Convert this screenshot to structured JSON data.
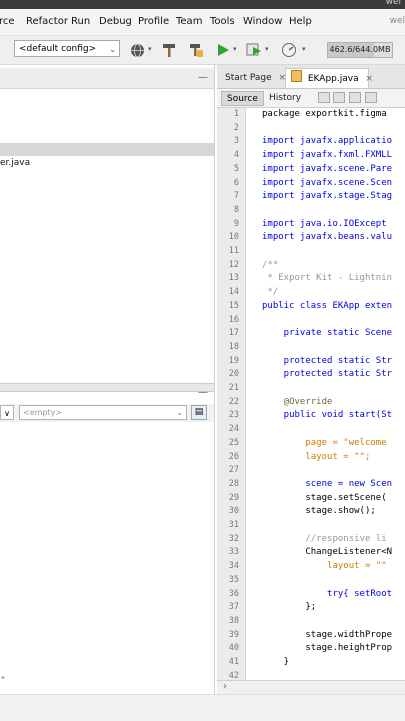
{
  "window": {
    "title_fragment": "wel"
  },
  "menu": [
    "rce",
    "Refactor",
    "Run",
    "Debug",
    "Profile",
    "Team",
    "Tools",
    "Window",
    "Help"
  ],
  "menu_user": "wel",
  "toolbar": {
    "config_value": "<default config>",
    "memory_text": "462.6/644.0MB",
    "memory_fraction": 0.72
  },
  "icons": {
    "globe": "globe-icon",
    "hammer": "hammer-icon",
    "clean_build": "clean-build-icon",
    "run": "run-icon",
    "debug": "debug-icon",
    "profile": "profile-icon"
  },
  "project_tree": {
    "file_partial": "er.java"
  },
  "navigator": {
    "combo1": "∨",
    "combo2_value": "<empty>"
  },
  "editor": {
    "tabs": [
      {
        "label": "Start Page",
        "close": "×"
      },
      {
        "label": "EKApp.java",
        "close": "×"
      }
    ],
    "source_label": "Source",
    "history_label": "History",
    "line_numbers": [
      "1",
      "2",
      "3",
      "4",
      "5",
      "6",
      "7",
      "8",
      "9",
      "10",
      "11",
      "12",
      "13",
      "14",
      "15",
      "16",
      "17",
      "18",
      "19",
      "20",
      "21",
      "22",
      "23",
      "24",
      "25",
      "26",
      "27",
      "28",
      "29",
      "30",
      "31",
      "32",
      "33",
      "34",
      "35",
      "36",
      "37",
      "38",
      "39",
      "40",
      "41",
      "42"
    ],
    "code_lines": [
      {
        "n": 1,
        "t": "package exportkit.figma",
        "c": "#000000"
      },
      {
        "n": 2,
        "t": "",
        "c": "#000000"
      },
      {
        "n": 3,
        "t": "import javafx.applicatio",
        "c": "#0000e6"
      },
      {
        "n": 4,
        "t": "import javafx.fxml.FXMLL",
        "c": "#0000e6"
      },
      {
        "n": 5,
        "t": "import javafx.scene.Pare",
        "c": "#0000e6"
      },
      {
        "n": 6,
        "t": "import javafx.scene.Scen",
        "c": "#0000e6"
      },
      {
        "n": 7,
        "t": "import javafx.stage.Stag",
        "c": "#0000e6"
      },
      {
        "n": 8,
        "t": "",
        "c": "#000000"
      },
      {
        "n": 9,
        "t": "import java.io.IOExcept",
        "c": "#0000e6"
      },
      {
        "n": 10,
        "t": "import javafx.beans.valu",
        "c": "#0000e6"
      },
      {
        "n": 11,
        "t": "",
        "c": "#000000"
      },
      {
        "n": 12,
        "t": "/**",
        "c": "#969696"
      },
      {
        "n": 13,
        "t": " * Export Kit - Lightnin",
        "c": "#969696"
      },
      {
        "n": 14,
        "t": " */",
        "c": "#969696"
      },
      {
        "n": 15,
        "t": "public class EKApp exten",
        "c": "#0000e6"
      },
      {
        "n": 16,
        "t": "",
        "c": "#000000"
      },
      {
        "n": 17,
        "t": "    private static Scene",
        "c": "#0000e6"
      },
      {
        "n": 18,
        "t": "",
        "c": "#000000"
      },
      {
        "n": 19,
        "t": "    protected static Str",
        "c": "#0000e6"
      },
      {
        "n": 20,
        "t": "    protected static Str",
        "c": "#0000e6"
      },
      {
        "n": 21,
        "t": "",
        "c": "#000000"
      },
      {
        "n": 22,
        "t": "    @Override",
        "c": "#6b6b3a"
      },
      {
        "n": 23,
        "t": "    public void start(St",
        "c": "#0000e6"
      },
      {
        "n": 24,
        "t": "",
        "c": "#000000"
      },
      {
        "n": 25,
        "t": "        page = \"welcome",
        "c": "#ce7b00"
      },
      {
        "n": 26,
        "t": "        layout = \"\";",
        "c": "#ce7b00"
      },
      {
        "n": 27,
        "t": "",
        "c": "#000000"
      },
      {
        "n": 28,
        "t": "        scene = new Scen",
        "c": "#0000e6"
      },
      {
        "n": 29,
        "t": "        stage.setScene(",
        "c": "#000000"
      },
      {
        "n": 30,
        "t": "        stage.show();",
        "c": "#000000"
      },
      {
        "n": 31,
        "t": "",
        "c": "#000000"
      },
      {
        "n": 32,
        "t": "        //responsive li",
        "c": "#969696"
      },
      {
        "n": 33,
        "t": "        ChangeListener<N",
        "c": "#000000"
      },
      {
        "n": 34,
        "t": "            layout = \"\"",
        "c": "#ce7b00"
      },
      {
        "n": 35,
        "t": "",
        "c": "#000000"
      },
      {
        "n": 36,
        "t": "            try{ setRoot",
        "c": "#0000e6"
      },
      {
        "n": 37,
        "t": "        };",
        "c": "#000000"
      },
      {
        "n": 38,
        "t": "",
        "c": "#000000"
      },
      {
        "n": 39,
        "t": "        stage.widthPrope",
        "c": "#000000"
      },
      {
        "n": 40,
        "t": "        stage.heightProp",
        "c": "#000000"
      },
      {
        "n": 41,
        "t": "    }",
        "c": "#000000"
      },
      {
        "n": 42,
        "t": "",
        "c": "#000000"
      }
    ]
  }
}
